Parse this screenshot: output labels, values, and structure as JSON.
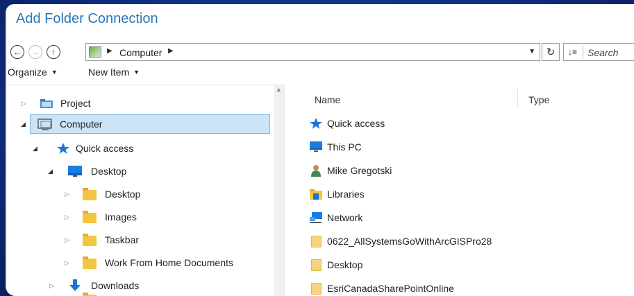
{
  "window": {
    "title": "Add Folder Connection"
  },
  "nav": {
    "back_icon": "arrow-left-icon",
    "forward_icon": "arrow-right-icon",
    "up_icon": "arrow-up-icon"
  },
  "address": {
    "path": "Computer",
    "refresh_icon": "refresh-icon"
  },
  "search": {
    "placeholder": "Search"
  },
  "toolbar": {
    "organize": "Organize",
    "new_item": "New Item"
  },
  "tree": [
    {
      "label": "Project",
      "icon": "project-folder-icon",
      "expander": "collapsed"
    },
    {
      "label": "Computer",
      "icon": "computer-icon",
      "expander": "expanded",
      "selected": true
    },
    {
      "label": "Quick access",
      "icon": "pin-icon",
      "expander": "expanded"
    },
    {
      "label": "Desktop",
      "icon": "desktop-icon",
      "expander": "expanded"
    },
    {
      "label": "Desktop",
      "icon": "folder-icon",
      "expander": "collapsed"
    },
    {
      "label": "Images",
      "icon": "folder-icon",
      "expander": "collapsed"
    },
    {
      "label": "Taskbar",
      "icon": "folder-icon",
      "expander": "collapsed"
    },
    {
      "label": "Work From Home Documents",
      "icon": "folder-icon",
      "expander": "collapsed"
    },
    {
      "label": "Downloads",
      "icon": "download-icon",
      "expander": "collapsed"
    }
  ],
  "columns": {
    "name": "Name",
    "type": "Type"
  },
  "list": [
    {
      "label": "Quick access",
      "icon": "pin-icon"
    },
    {
      "label": "This PC",
      "icon": "monitor-icon"
    },
    {
      "label": "Mike Gregotski",
      "icon": "user-icon"
    },
    {
      "label": "Libraries",
      "icon": "libraries-icon"
    },
    {
      "label": "Network",
      "icon": "network-icon"
    },
    {
      "label": "0622_AllSystemsGoWithArcGISPro28",
      "icon": "folder-icon"
    },
    {
      "label": "Desktop",
      "icon": "folder-icon"
    },
    {
      "label": "EsriCanadaSharePointOnline",
      "icon": "folder-icon"
    }
  ]
}
